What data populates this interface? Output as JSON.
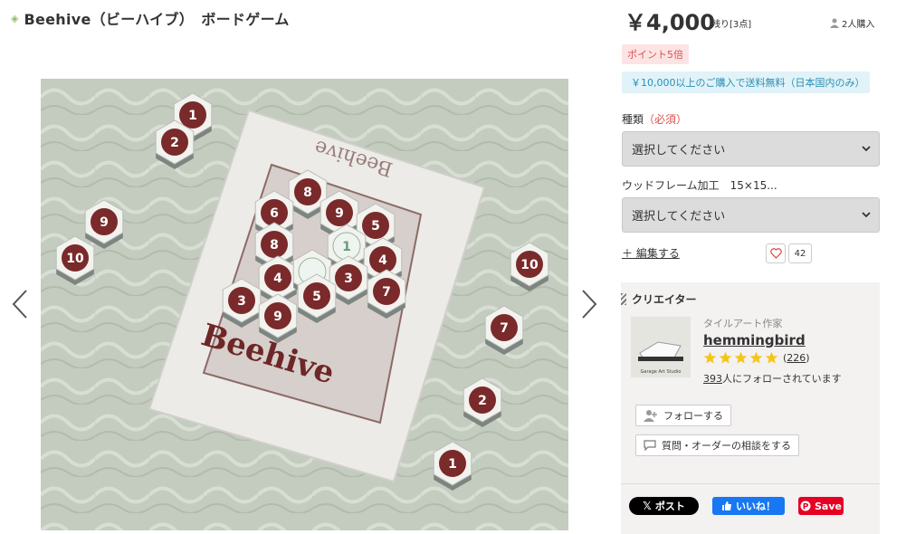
{
  "product": {
    "title": "Beehive（ビーハイブ）　ボードゲーム",
    "image_alt": "Beehive board game tiles on a tablecloth",
    "board_word": "Beehive"
  },
  "pricing": {
    "price": "￥4,000",
    "stock": "残り[3点]",
    "buyers": "2人購入",
    "points_badge": "ポイント5倍",
    "shipping_badge": "￥10,000以上のご購入で送料無料（日本国内のみ）"
  },
  "options": {
    "kind_label": "種類",
    "required": "（必須）",
    "kind_placeholder": "選択してください",
    "frame_label": "ウッドフレーム加工　15×15...",
    "frame_placeholder": "選択してください"
  },
  "actions": {
    "edit": "＋ 編集する",
    "fav_count": "42"
  },
  "creator": {
    "heading": "クリエイター",
    "role": "タイルアート作家",
    "name": "hemmingbird",
    "rating": 5,
    "review_count": "226",
    "followers_num": "393",
    "followers_text": "人にフォローされています",
    "follow_label": "フォローする",
    "inquiry_label": "質問・オーダーの相談をする",
    "avatar_text": "Garage Art Studio"
  },
  "share": {
    "x_label": "ポスト",
    "fb_label": "いいね！",
    "pin_label": "Save"
  },
  "colors": {
    "accent_red": "#d9534f",
    "star": "#f5c518",
    "tile_maroon": "#7a2a2a"
  }
}
